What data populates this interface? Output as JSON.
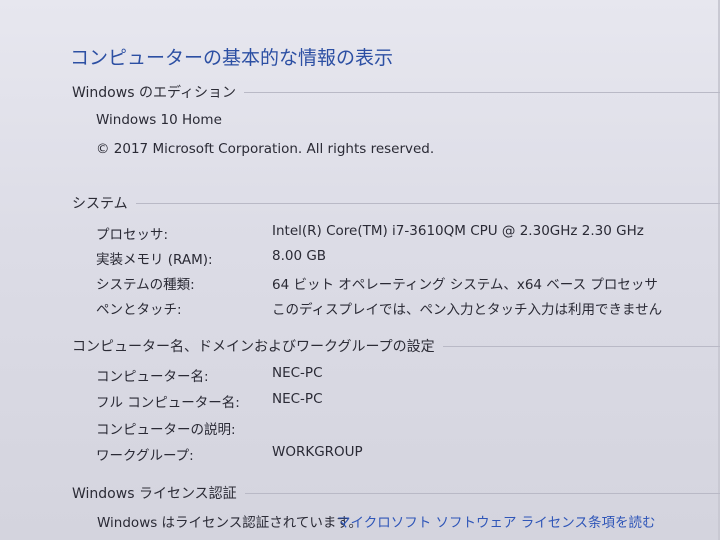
{
  "page": {
    "title": "コンピューターの基本的な情報の表示"
  },
  "edition": {
    "header": "Windows のエディション",
    "name": "Windows 10 Home",
    "copyright": "© 2017 Microsoft Corporation. All rights reserved."
  },
  "system": {
    "header": "システム",
    "rows": [
      {
        "label": "プロセッサ:",
        "value": "Intel(R) Core(TM) i7-3610QM CPU @ 2.30GHz   2.30 GHz"
      },
      {
        "label": "実装メモリ (RAM):",
        "value": "8.00 GB"
      },
      {
        "label": "システムの種類:",
        "value": "64 ビット オペレーティング システム、x64 ベース プロセッサ"
      },
      {
        "label": "ペンとタッチ:",
        "value": "このディスプレイでは、ペン入力とタッチ入力は利用できません"
      }
    ]
  },
  "computer": {
    "header": "コンピューター名、ドメインおよびワークグループの設定",
    "rows": [
      {
        "label": "コンピューター名:",
        "value": "NEC-PC"
      },
      {
        "label": "フル コンピューター名:",
        "value": "NEC-PC"
      },
      {
        "label": "コンピューターの説明:",
        "value": ""
      },
      {
        "label": "ワークグループ:",
        "value": "WORKGROUP"
      }
    ]
  },
  "license": {
    "header": "Windows ライセンス認証",
    "status": "Windows はライセンス認証されています。",
    "link": "マイクロソフト ソフトウェア ライセンス条項を読む"
  },
  "colors": {
    "title": "#2c4fa3",
    "link": "#2f56b8",
    "rule": "#b9b9c6"
  }
}
